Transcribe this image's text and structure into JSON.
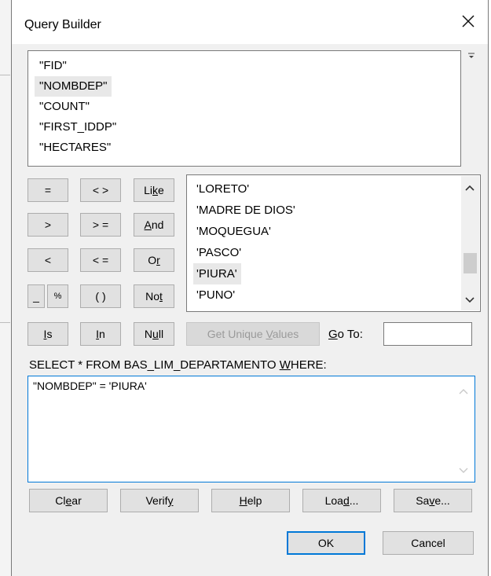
{
  "window": {
    "title": "Query Builder"
  },
  "fields": [
    "\"FID\"",
    "\"NOMBDEP\"",
    "\"COUNT\"",
    "\"FIRST_IDDP\"",
    "\"HECTARES\""
  ],
  "selected_field": "\"NOMBDEP\"",
  "operators": {
    "equals": "=",
    "not_equal": "< >",
    "like": [
      "Li",
      "k",
      "e"
    ],
    "greater": ">",
    "greater_equal": "> =",
    "and": [
      "",
      "A",
      "nd"
    ],
    "less": "<",
    "less_equal": "< =",
    "or": [
      "O",
      "r",
      ""
    ],
    "underscore": "_",
    "percent": "%",
    "parens": "( )",
    "not": [
      "No",
      "t",
      ""
    ],
    "is": [
      "",
      "I",
      "s"
    ],
    "in": [
      "",
      "I",
      "n"
    ],
    "null": [
      "N",
      "u",
      "ll"
    ]
  },
  "values": [
    "'LORETO'",
    "'MADRE DE DIOS'",
    "'MOQUEGUA'",
    "'PASCO'",
    "'PIURA'",
    "'PUNO'"
  ],
  "selected_value": "'PIURA'",
  "get_unique_values": [
    "Get Unique ",
    "V",
    "alues"
  ],
  "goto": {
    "label": [
      "",
      "G",
      "o To:"
    ],
    "value": ""
  },
  "sql_header": [
    "SELECT * FROM BAS_LIM_DEPARTAMENTO ",
    "W",
    "HERE:"
  ],
  "expression": "\"NOMBDEP\" = 'PIURA'",
  "actions": {
    "clear": [
      "Cl",
      "e",
      "ar"
    ],
    "verify": [
      "Verif",
      "y",
      ""
    ],
    "help": [
      "",
      "H",
      "elp"
    ],
    "load": [
      "Loa",
      "d",
      "..."
    ],
    "save": [
      "Sa",
      "v",
      "e..."
    ]
  },
  "ok": "OK",
  "cancel": "Cancel",
  "colors": {
    "accent": "#0078d7",
    "selection": "#e8e8e8",
    "disabled_text": "#9a9a9a"
  }
}
